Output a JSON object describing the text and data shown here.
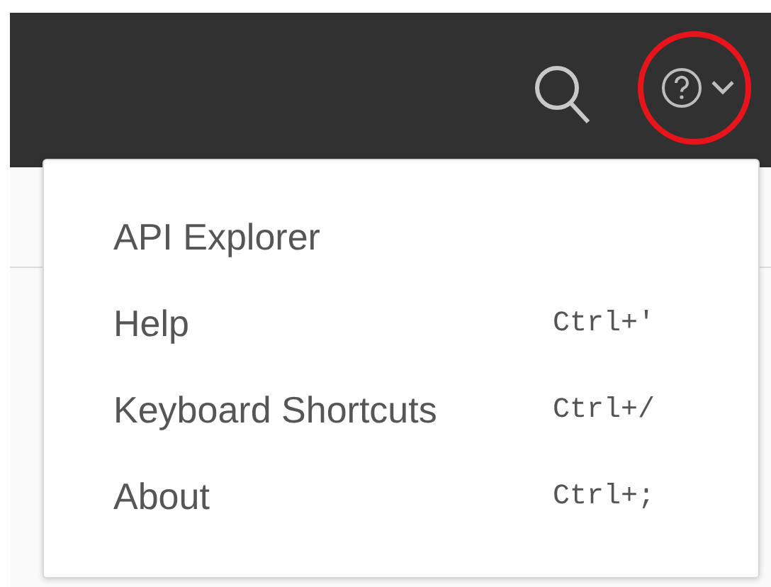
{
  "help_menu": {
    "items": [
      {
        "label": "API Explorer"
      },
      {
        "label": "Help",
        "shortcut": "Ctrl+'"
      },
      {
        "label": "Keyboard Shortcuts",
        "shortcut": "Ctrl+/"
      },
      {
        "label": "About",
        "shortcut": "Ctrl+;"
      }
    ]
  }
}
